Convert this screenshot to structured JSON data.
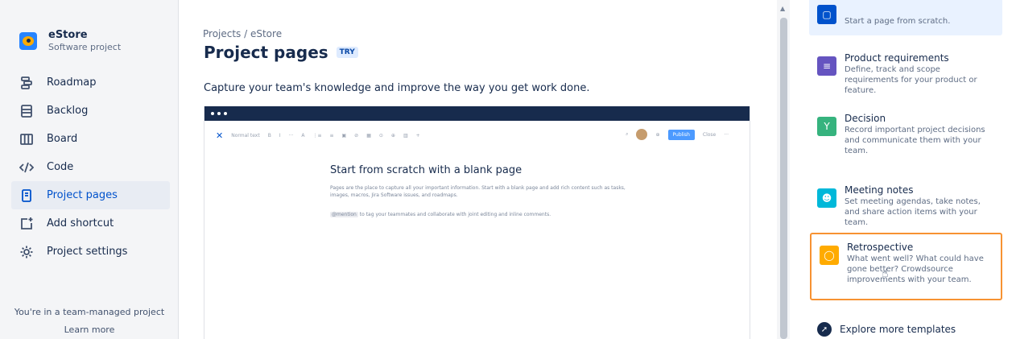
{
  "sidebar": {
    "project_name": "eStore",
    "project_type": "Software project",
    "items": [
      {
        "label": "Roadmap",
        "icon": "roadmap-icon"
      },
      {
        "label": "Backlog",
        "icon": "backlog-icon"
      },
      {
        "label": "Board",
        "icon": "board-icon"
      },
      {
        "label": "Code",
        "icon": "code-icon"
      },
      {
        "label": "Project pages",
        "icon": "project-pages-icon",
        "active": true
      },
      {
        "label": "Add shortcut",
        "icon": "add-shortcut-icon"
      },
      {
        "label": "Project settings",
        "icon": "gear-icon"
      }
    ],
    "footer_text": "You're in a team-managed project",
    "footer_link": "Learn more"
  },
  "main": {
    "breadcrumb": "Projects / eStore",
    "title": "Project pages",
    "badge": "TRY",
    "description": "Capture your team's knowledge and improve the way you get work done."
  },
  "preview": {
    "toolbar_format": "Normal text",
    "toolbar_items": [
      "B",
      "I",
      "···",
      "A",
      "⋮≡",
      "≡",
      "▣",
      "⊘",
      "▦",
      "⊙",
      "⊕",
      "▥",
      "+"
    ],
    "publish_label": "Publish",
    "close_label": "Close",
    "more_label": "···",
    "heading": "Start from scratch with a blank page",
    "body": "Pages are the place to capture all your important information. Start with a blank page and add rich content such as tasks, images, macros, Jira Software issues, and roadmaps.",
    "mention": "@mention",
    "body2": "to tag your teammates and collaborate with joint editing and inline comments."
  },
  "templates": [
    {
      "title": "",
      "desc": "Start a page from scratch.",
      "color": "#0052cc",
      "selected": true
    },
    {
      "title": "Product requirements",
      "desc": "Define, track and scope requirements for your product or feature.",
      "color": "#6554c0"
    },
    {
      "title": "Decision",
      "desc": "Record important project decisions and communicate them with your team.",
      "color": "#36b37e"
    },
    {
      "title": "Meeting notes",
      "desc": "Set meeting agendas, take notes, and share action items with your team.",
      "color": "#00b8d9"
    },
    {
      "title": "Retrospective",
      "desc": "What went well? What could have gone better? Crowdsource improvements with your team.",
      "color": "#ffab00",
      "hover": true
    }
  ],
  "explore_label": "Explore more templates",
  "colors": {
    "accent": "#0052cc",
    "highlight_border": "#f79232"
  }
}
